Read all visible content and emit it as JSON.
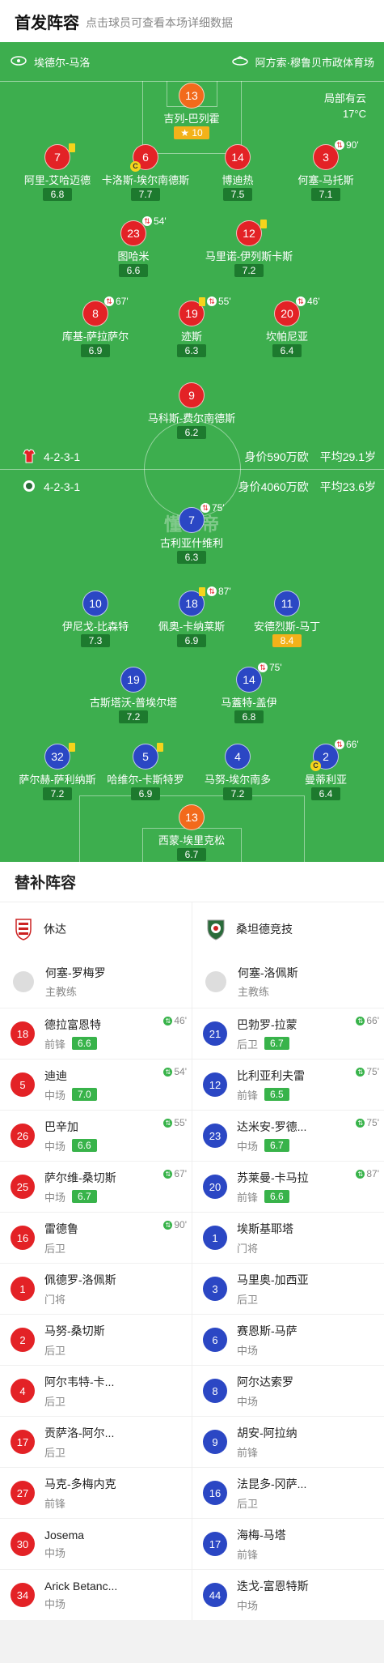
{
  "header": {
    "title": "首发阵容",
    "hint": "点击球员可查看本场详细数据"
  },
  "pitch": {
    "home_team": "埃德尔-马洛",
    "away_team": "阿方索·穆鲁贝市政体育场",
    "weather": "局部有云",
    "temperature": "17°C",
    "watermark": "懂球帝",
    "home_formation": {
      "formation": "4-2-3-1",
      "value": "身价590万欧",
      "age": "平均29.1岁"
    },
    "away_formation": {
      "formation": "4-2-3-1",
      "value": "身价4060万欧",
      "age": "平均23.6岁"
    },
    "star_value": "10",
    "sub_icon": "⇅",
    "captain_mark": "C"
  },
  "home_players": [
    {
      "num": "13",
      "name": "吉列-巴列霍",
      "rating": "10"
    },
    {
      "num": "7",
      "name": "阿里-艾哈迈德",
      "rating": "6.8"
    },
    {
      "num": "6",
      "name": "卡洛斯-埃尔南德斯",
      "rating": "7.7"
    },
    {
      "num": "14",
      "name": "博迪热",
      "rating": "7.5"
    },
    {
      "num": "3",
      "name": "何塞-马托斯",
      "rating": "7.1",
      "sub": "90'"
    },
    {
      "num": "23",
      "name": "图哈米",
      "rating": "6.6",
      "sub": "54'"
    },
    {
      "num": "12",
      "name": "马里诺-伊列斯卡斯",
      "rating": "7.2"
    },
    {
      "num": "8",
      "name": "库基-萨拉萨尔",
      "rating": "6.9",
      "sub": "67'"
    },
    {
      "num": "19",
      "name": "迹斯",
      "rating": "6.3",
      "sub": "55'"
    },
    {
      "num": "20",
      "name": "坎帕尼亚",
      "rating": "6.4",
      "sub": "46'"
    },
    {
      "num": "9",
      "name": "马科斯-费尔南德斯",
      "rating": "6.2"
    }
  ],
  "away_players": [
    {
      "num": "7",
      "name": "古利亚什维利",
      "rating": "6.3",
      "sub": "75'"
    },
    {
      "num": "10",
      "name": "伊尼戈-比森特",
      "rating": "7.3"
    },
    {
      "num": "18",
      "name": "佩奥-卡纳莱斯",
      "rating": "6.9",
      "sub": "87'"
    },
    {
      "num": "11",
      "name": "安德烈斯-马丁",
      "rating": "8.4"
    },
    {
      "num": "19",
      "name": "古斯塔沃-普埃尔塔",
      "rating": "7.2"
    },
    {
      "num": "14",
      "name": "马蓋特-盖伊",
      "rating": "6.8",
      "sub": "75'"
    },
    {
      "num": "32",
      "name": "萨尔赫-萨利纳斯",
      "rating": "7.2"
    },
    {
      "num": "5",
      "name": "哈维尔-卡斯特罗",
      "rating": "6.9"
    },
    {
      "num": "4",
      "name": "马努-埃尔南多",
      "rating": "7.2"
    },
    {
      "num": "2",
      "name": "曼蒂利亚",
      "rating": "6.4",
      "sub": "66'"
    },
    {
      "num": "13",
      "name": "西蒙-埃里克松",
      "rating": "6.7"
    }
  ],
  "subs": {
    "title": "替补阵容",
    "home": {
      "team": "休达",
      "coach": {
        "name": "何塞-罗梅罗",
        "role": "主教练"
      },
      "players": [
        {
          "num": "18",
          "name": "德拉富恩特",
          "pos": "前锋",
          "rating": "6.6",
          "in": "46'"
        },
        {
          "num": "5",
          "name": "迪迪",
          "pos": "中场",
          "rating": "7.0",
          "in": "54'"
        },
        {
          "num": "26",
          "name": "巴辛加",
          "pos": "中场",
          "rating": "6.6",
          "in": "55'"
        },
        {
          "num": "25",
          "name": "萨尔维-桑切斯",
          "pos": "中场",
          "rating": "6.7",
          "in": "67'"
        },
        {
          "num": "16",
          "name": "雷德鲁",
          "pos": "后卫",
          "rating": "",
          "in": "90'"
        },
        {
          "num": "1",
          "name": "佩德罗-洛佩斯",
          "pos": "门将",
          "rating": "",
          "in": ""
        },
        {
          "num": "2",
          "name": "马努-桑切斯",
          "pos": "后卫",
          "rating": "",
          "in": ""
        },
        {
          "num": "4",
          "name": "阿尔韦特-卡...",
          "pos": "后卫",
          "rating": "",
          "in": ""
        },
        {
          "num": "17",
          "name": "贡萨洛-阿尔...",
          "pos": "后卫",
          "rating": "",
          "in": ""
        },
        {
          "num": "27",
          "name": "马克-多梅内克",
          "pos": "前锋",
          "rating": "",
          "in": ""
        },
        {
          "num": "30",
          "name": "Josema",
          "pos": "中场",
          "rating": "",
          "in": ""
        },
        {
          "num": "34",
          "name": "Arick Betanc...",
          "pos": "中场",
          "rating": "",
          "in": ""
        }
      ]
    },
    "away": {
      "team": "桑坦德竞技",
      "coach": {
        "name": "何塞-洛佩斯",
        "role": "主教练"
      },
      "players": [
        {
          "num": "21",
          "name": "巴勃罗-拉蒙",
          "pos": "后卫",
          "rating": "6.7",
          "in": "66'"
        },
        {
          "num": "12",
          "name": "比利亚利夫雷",
          "pos": "前锋",
          "rating": "6.5",
          "in": "75'"
        },
        {
          "num": "23",
          "name": "达米安-罗德...",
          "pos": "中场",
          "rating": "6.7",
          "in": "75'"
        },
        {
          "num": "20",
          "name": "苏莱曼-卡马拉",
          "pos": "前锋",
          "rating": "6.6",
          "in": "87'"
        },
        {
          "num": "1",
          "name": "埃斯基耶塔",
          "pos": "门将",
          "rating": "",
          "in": ""
        },
        {
          "num": "3",
          "name": "马里奥-加西亚",
          "pos": "后卫",
          "rating": "",
          "in": ""
        },
        {
          "num": "6",
          "name": "赛恩斯-马萨",
          "pos": "中场",
          "rating": "",
          "in": ""
        },
        {
          "num": "8",
          "name": "阿尔达索罗",
          "pos": "中场",
          "rating": "",
          "in": ""
        },
        {
          "num": "9",
          "name": "胡安-阿拉纳",
          "pos": "前锋",
          "rating": "",
          "in": ""
        },
        {
          "num": "16",
          "name": "法昆多-冈萨...",
          "pos": "后卫",
          "rating": "",
          "in": ""
        },
        {
          "num": "17",
          "name": "海梅-马塔",
          "pos": "前锋",
          "rating": "",
          "in": ""
        },
        {
          "num": "44",
          "name": "迭戈-富恩特斯",
          "pos": "中场",
          "rating": "",
          "in": ""
        }
      ]
    }
  }
}
